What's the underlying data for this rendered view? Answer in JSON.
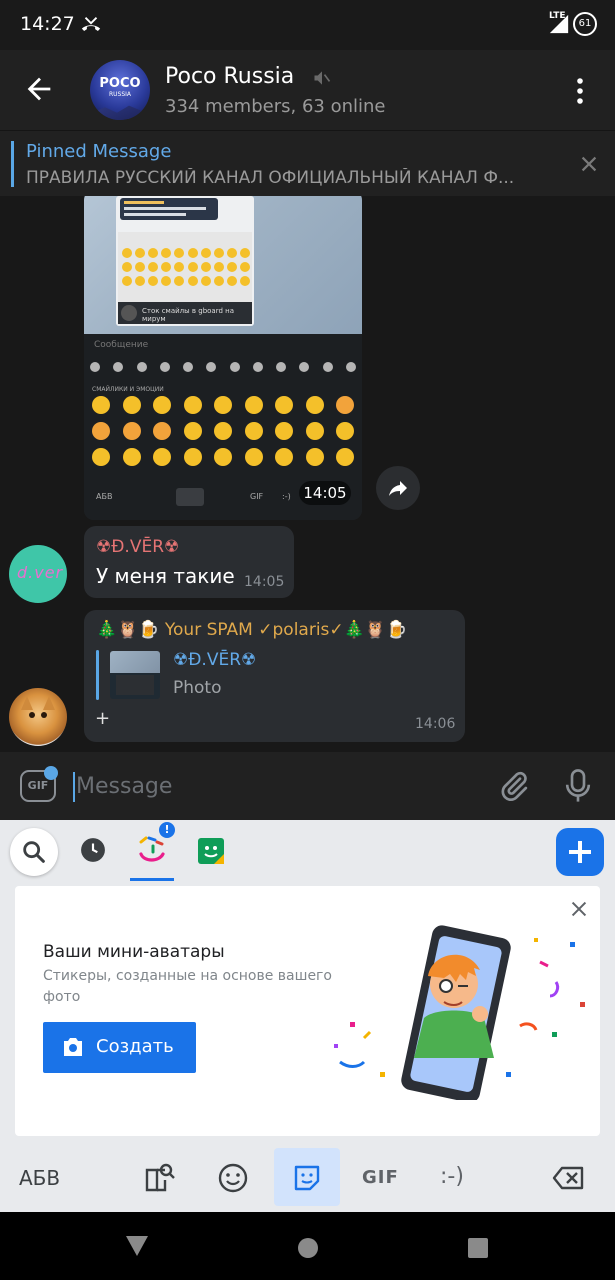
{
  "status_bar": {
    "time": "14:27",
    "network_label": "LTE",
    "battery": "61"
  },
  "header": {
    "title": "Poco Russia",
    "subtitle": "334 members, 63 online",
    "avatar_text": "POCO",
    "avatar_subtext": "RUSSIA"
  },
  "pinned": {
    "title": "Pinned Message",
    "text": "ПРАВИЛА РУССКИЙ КАНАЛ ОФИЦИАЛЬНЫЙ КАНАЛ Ф..."
  },
  "messages": [
    {
      "type": "photo",
      "time": "14:05",
      "embedded": {
        "mini_caption": "Сток смайлы в gboard на мирум",
        "input_placeholder": "Сообщение",
        "category_header": "СМАЙЛИКИ И ЭМОЦИИ",
        "bottom_bar": [
          "АБВ",
          "GIF",
          ":-)"
        ]
      }
    },
    {
      "type": "text",
      "sender": "☢Đ.VĒR☢",
      "text": "У меня такие",
      "time": "14:05",
      "avatar_text": "d.ver"
    },
    {
      "type": "reply",
      "sender": "🎄🦉🍺 Your SPAM ✓polaris✓🎄🦉🍺",
      "quoted_sender": "☢Đ.VĒR☢",
      "quoted_text": "Photo",
      "text": "+",
      "time": "14:06"
    }
  ],
  "composer": {
    "placeholder": "Message",
    "gif_label": "GIF"
  },
  "keyboard": {
    "card": {
      "title": "Ваши мини-аватары",
      "description": "Стикеры, созданные на основе вашего фото",
      "button_label": "Создать"
    },
    "bottom": {
      "abc_label": "АБВ",
      "gif_label": "GIF",
      "emoticon_label": ":-)"
    },
    "accent_color": "#1a73e8"
  },
  "colors": {
    "link": "#62a9e8",
    "sender_red": "#e57474",
    "sender_orange": "#e0a94c"
  }
}
